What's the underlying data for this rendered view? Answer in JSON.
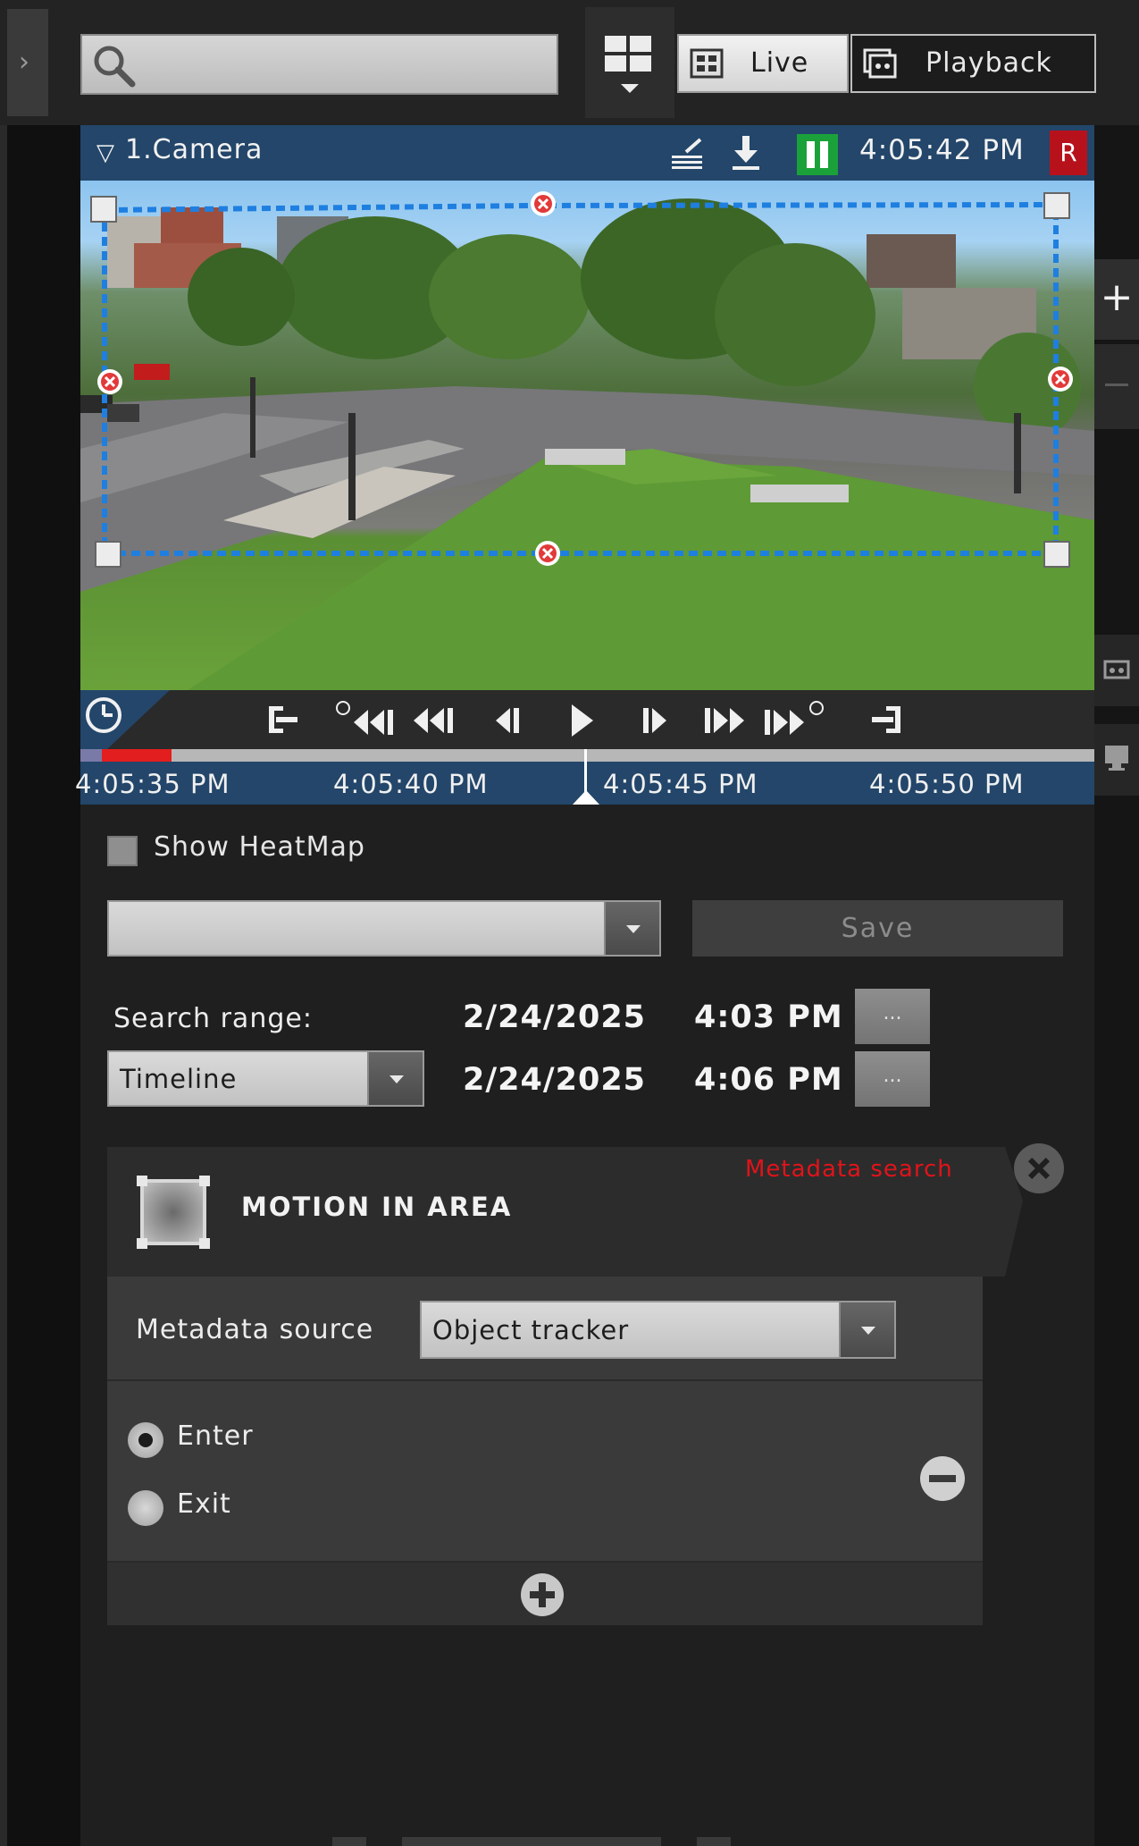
{
  "toolbar": {
    "search_value": "",
    "live_label": "Live",
    "playback_label": "Playback"
  },
  "camera": {
    "title": "1.Camera",
    "time": "4:05:42 PM",
    "record_badge": "R"
  },
  "timeline": {
    "labels": [
      "4:05:35 PM",
      "4:05:40 PM",
      "4:05:45 PM",
      "4:05:50 PM"
    ],
    "played_fraction": 0.09
  },
  "search": {
    "show_heatmap_label": "Show HeatMap",
    "show_heatmap_checked": false,
    "preset_value": "",
    "save_label": "Save",
    "range_label": "Search range:",
    "range_mode": "Timeline",
    "from_date": "2/24/2025",
    "from_time": "4:03 PM",
    "to_date": "2/24/2025",
    "to_time": "4:06 PM",
    "more_label": "..."
  },
  "criteria": {
    "title": "MOTION IN AREA",
    "tag": "Metadata search",
    "source_label": "Metadata source",
    "source_value": "Object tracker",
    "options": [
      {
        "label": "Enter",
        "selected": true
      },
      {
        "label": "Exit",
        "selected": false
      }
    ]
  },
  "colors": {
    "header_blue": "#23466a",
    "pause_green": "#1ba13a",
    "record_red": "#b7121c",
    "tag_red": "#e0141a",
    "zone_blue": "#1e7fe0"
  },
  "icons": [
    "search-icon",
    "layout-grid-icon",
    "live-icon",
    "playback-icon",
    "filter-icon",
    "edit-icon",
    "download-icon",
    "pause-icon",
    "clock-icon",
    "go-start-icon",
    "rewind-fast-icon",
    "rewind-icon",
    "step-back-icon",
    "play-icon",
    "step-forward-icon",
    "forward-icon",
    "forward-fast-icon",
    "go-end-icon",
    "close-icon",
    "minus-icon",
    "plus-icon",
    "zone-icon"
  ]
}
